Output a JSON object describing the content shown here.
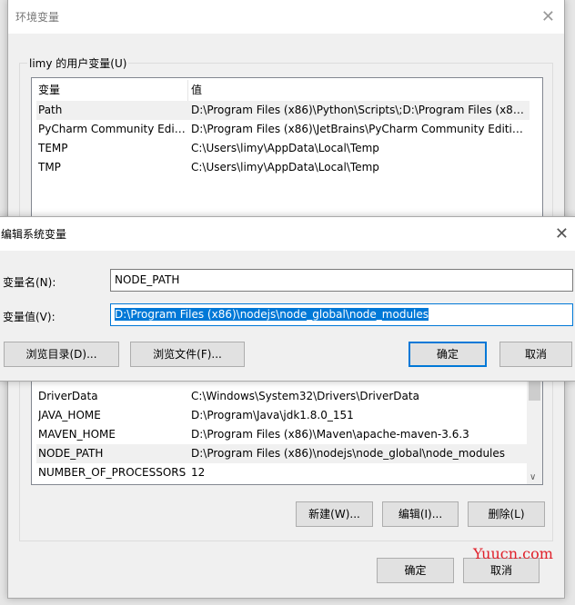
{
  "env_dialog": {
    "title": "环境变量",
    "user_group_label": "limy 的用户变量(U)",
    "columns": [
      "变量",
      "值"
    ],
    "user_vars": [
      {
        "name": "Path",
        "value": "D:\\Program Files (x86)\\Python\\Scripts\\;D:\\Program Files (x86)..."
      },
      {
        "name": "PyCharm Community Editi...",
        "value": "D:\\Program Files (x86)\\JetBrains\\PyCharm Community Edition..."
      },
      {
        "name": "TEMP",
        "value": "C:\\Users\\limy\\AppData\\Local\\Temp"
      },
      {
        "name": "TMP",
        "value": "C:\\Users\\limy\\AppData\\Local\\Temp"
      }
    ],
    "system_vars": [
      {
        "name": "DriverData",
        "value": "C:\\Windows\\System32\\Drivers\\DriverData"
      },
      {
        "name": "JAVA_HOME",
        "value": "D:\\Program\\Java\\jdk1.8.0_151"
      },
      {
        "name": "MAVEN_HOME",
        "value": "D:\\Program Files (x86)\\Maven\\apache-maven-3.6.3"
      },
      {
        "name": "NODE_PATH",
        "value": "D:\\Program Files (x86)\\nodejs\\node_global\\node_modules"
      },
      {
        "name": "NUMBER_OF_PROCESSORS",
        "value": "12"
      }
    ],
    "new_label": "新建(W)...",
    "edit_label": "编辑(I)...",
    "delete_label": "删除(L)",
    "ok_label": "确定",
    "cancel_label": "取消"
  },
  "edit_dialog": {
    "title": "编辑系统变量",
    "name_label": "变量名(N):",
    "name_value": "NODE_PATH",
    "value_label": "变量值(V):",
    "value_value": "D:\\Program Files (x86)\\nodejs\\node_global\\node_modules",
    "browse_dir_label": "浏览目录(D)...",
    "browse_file_label": "浏览文件(F)...",
    "ok_label": "确定",
    "cancel_label": "取消"
  },
  "watermark": "Yuucn.com",
  "accent_color": "#0078d7"
}
